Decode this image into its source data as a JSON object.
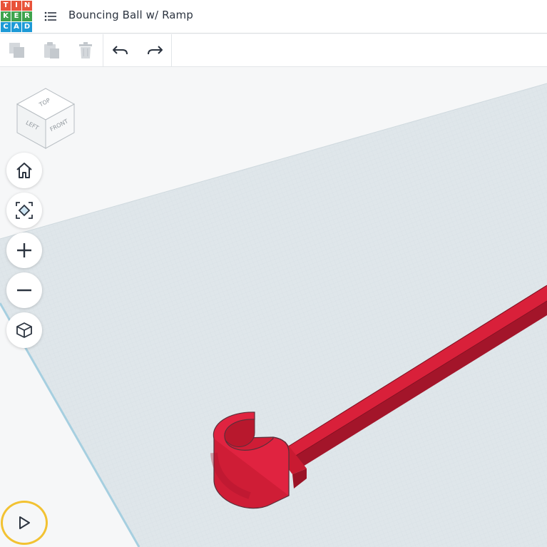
{
  "app": {
    "logo_letters": [
      "T",
      "I",
      "N",
      "K",
      "E",
      "R",
      "C",
      "A",
      "D"
    ],
    "logo_colors": [
      "#e8533a",
      "#e8533a",
      "#e8533a",
      "#3fa34d",
      "#3fa34d",
      "#3fa34d",
      "#1d9ad6",
      "#1d9ad6",
      "#1d9ad6"
    ],
    "menu_icon": "list-icon",
    "project_title": "Bouncing Ball w/ Ramp"
  },
  "toolbar": {
    "buttons": [
      {
        "name": "copy",
        "icon": "copy-icon",
        "enabled": false
      },
      {
        "name": "paste",
        "icon": "paste-icon",
        "enabled": false
      },
      {
        "name": "delete",
        "icon": "trash-icon",
        "enabled": false
      },
      {
        "name": "undo",
        "icon": "undo-icon",
        "enabled": true
      },
      {
        "name": "redo",
        "icon": "redo-icon",
        "enabled": true
      }
    ]
  },
  "viewcube": {
    "faces": {
      "top": "TOP",
      "left": "LEFT",
      "front": "FRONT"
    }
  },
  "view_controls": [
    {
      "name": "home-view",
      "icon": "home-icon"
    },
    {
      "name": "fit-all",
      "icon": "fit-view-icon"
    },
    {
      "name": "zoom-in",
      "icon": "plus-icon"
    },
    {
      "name": "zoom-out",
      "icon": "minus-icon"
    },
    {
      "name": "projection",
      "icon": "cube-icon"
    }
  ],
  "simulation": {
    "play_icon": "play-icon",
    "highlight_color": "#f2c232"
  },
  "colors": {
    "workplane": "#dfe6ea",
    "workplane_edge": "#a6cfe0",
    "shape_red": "#d9203a",
    "accent_dark": "#2c3440"
  }
}
